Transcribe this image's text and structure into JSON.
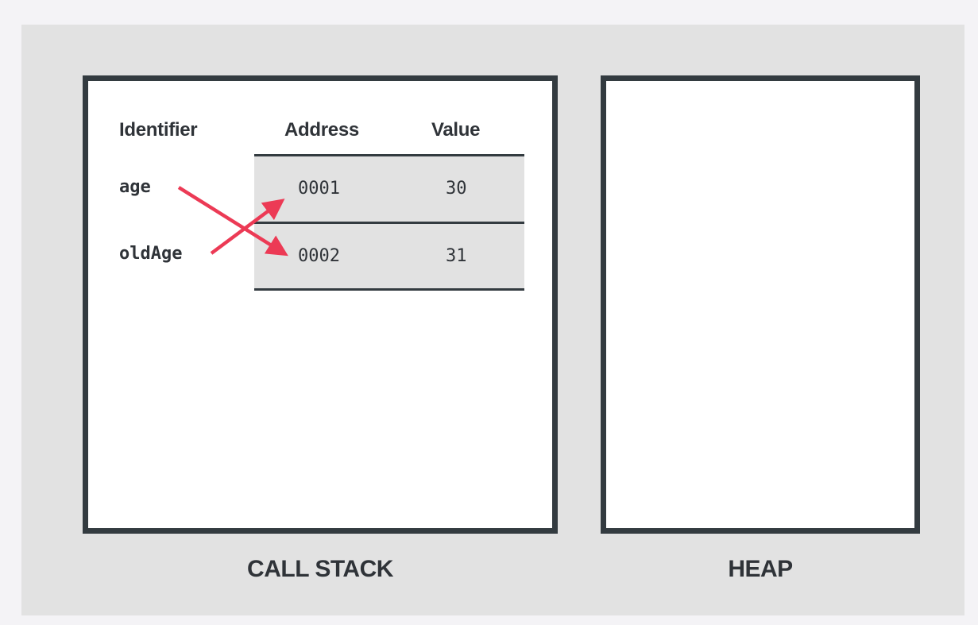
{
  "call_stack": {
    "caption": "CALL STACK",
    "headers": {
      "identifier": "Identifier",
      "address": "Address",
      "value": "Value"
    },
    "rows": [
      {
        "identifier": "age",
        "address": "0001",
        "value": "30"
      },
      {
        "identifier": "oldAge",
        "address": "0002",
        "value": "31"
      }
    ],
    "arrows": [
      {
        "from": "age",
        "to": "0002"
      },
      {
        "from": "oldAge",
        "to": "0001"
      }
    ]
  },
  "heap": {
    "caption": "HEAP"
  },
  "colors": {
    "background": "#f4f3f6",
    "panel": "#e2e2e2",
    "border": "#333b40",
    "text": "#2f3338",
    "arrow": "#ec3a55"
  }
}
